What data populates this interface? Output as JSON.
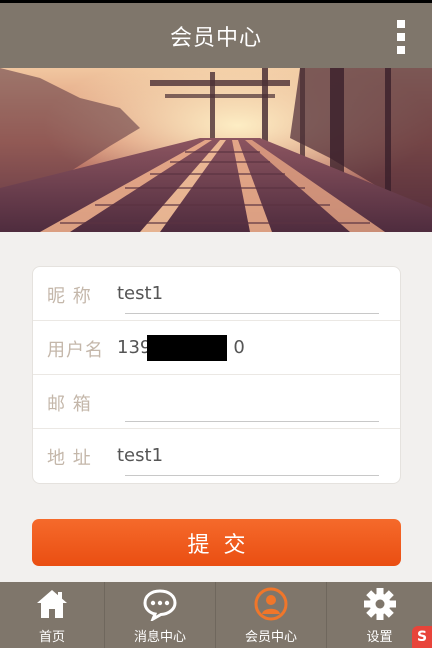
{
  "header": {
    "title": "会员中心",
    "menu_icon": "more-vertical-icon"
  },
  "banner": {
    "image": "railway-tracks-sunset-photo"
  },
  "form": {
    "fields": [
      {
        "label": "昵 称",
        "value": "test1"
      },
      {
        "label": "用户名",
        "value_prefix": "139",
        "value_suffix": "0"
      },
      {
        "label": "邮 箱",
        "value": ""
      },
      {
        "label": "地 址",
        "value": "test1"
      }
    ]
  },
  "submit": {
    "label": "提交"
  },
  "tabbar": {
    "active_color": "#f0762a",
    "tabs": [
      {
        "label": "首页",
        "icon": "home-icon"
      },
      {
        "label": "消息中心",
        "icon": "chat-bubble-icon"
      },
      {
        "label": "会员中心",
        "icon": "user-profile-icon",
        "active": true
      },
      {
        "label": "设置",
        "icon": "gear-icon"
      }
    ]
  },
  "colors": {
    "header_bg": "#7f766b",
    "accent": "#ea4e12",
    "label": "#c4b7aa"
  }
}
